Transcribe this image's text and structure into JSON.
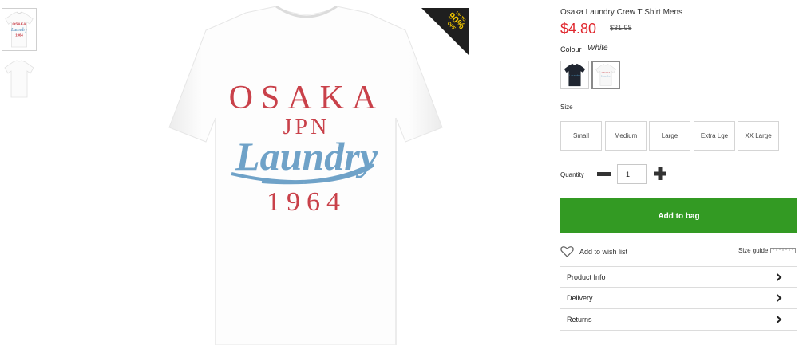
{
  "product": {
    "title": "Osaka Laundry Crew T Shirt Mens",
    "price_now": "$4.80",
    "price_was": "$31.98",
    "promo_badge": {
      "line1": "UP TO",
      "line2": "90%",
      "line3": "OFF"
    },
    "print": {
      "line1": "OSAKA",
      "line2": "JPN",
      "line3": "Laundry",
      "line4": "1964"
    }
  },
  "colour": {
    "label": "Colour",
    "value": "White",
    "swatches": [
      {
        "name": "Navy",
        "color": "#1f2530"
      },
      {
        "name": "White",
        "color": "#ffffff"
      }
    ]
  },
  "size": {
    "label": "Size",
    "options": [
      "Small",
      "Medium",
      "Large",
      "Extra Lge",
      "XX Large"
    ]
  },
  "quantity": {
    "label": "Quantity",
    "value": "1"
  },
  "actions": {
    "add_to_bag": "Add to bag",
    "wish_list": "Add to wish list",
    "size_guide": "Size guide"
  },
  "accordion": [
    "Product Info",
    "Delivery",
    "Returns"
  ],
  "colors": {
    "price_red": "#e0272e",
    "add_green": "#339a23",
    "print_red": "#c9414a",
    "print_blue": "#6fa2c8"
  }
}
